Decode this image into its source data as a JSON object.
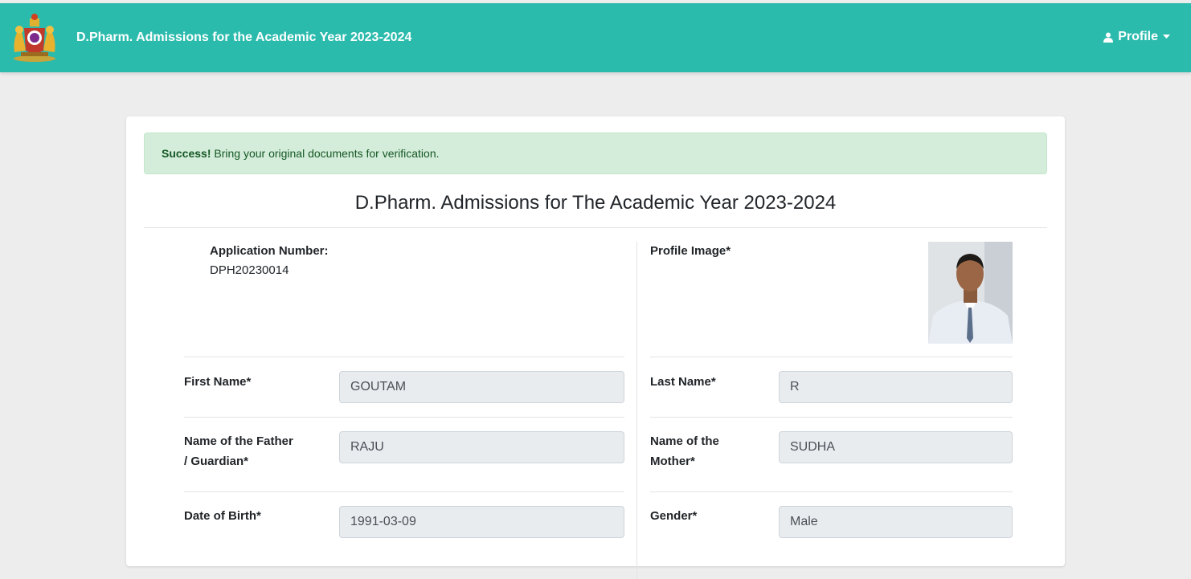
{
  "header": {
    "title": "D.Pharm. Admissions for the Academic Year 2023-2024",
    "profile_label": "Profile",
    "logo": "karnataka-state-emblem",
    "bg_color": "#2bbbad"
  },
  "alert": {
    "strong": "Success!",
    "message": " Bring your original documents for verification.",
    "color": "#d4edda"
  },
  "form": {
    "heading": "D.Pharm. Admissions for The Academic Year 2023-2024",
    "application_number": {
      "label": "Application Number:",
      "value": "DPH20230014"
    },
    "profile_image": {
      "label": "Profile Image*"
    },
    "first_name": {
      "label": "First Name*",
      "value": "GOUTAM"
    },
    "last_name": {
      "label": "Last Name*",
      "value": "R"
    },
    "father_name": {
      "label_line1": "Name of the Father",
      "label_line2": "/ Guardian*",
      "value": "RAJU"
    },
    "mother_name": {
      "label_line1": "Name of the",
      "label_line2": "Mother*",
      "value": "SUDHA"
    },
    "dob": {
      "label": "Date of Birth*",
      "value": "1991-03-09"
    },
    "gender": {
      "label": "Gender*",
      "value": "Male"
    }
  }
}
